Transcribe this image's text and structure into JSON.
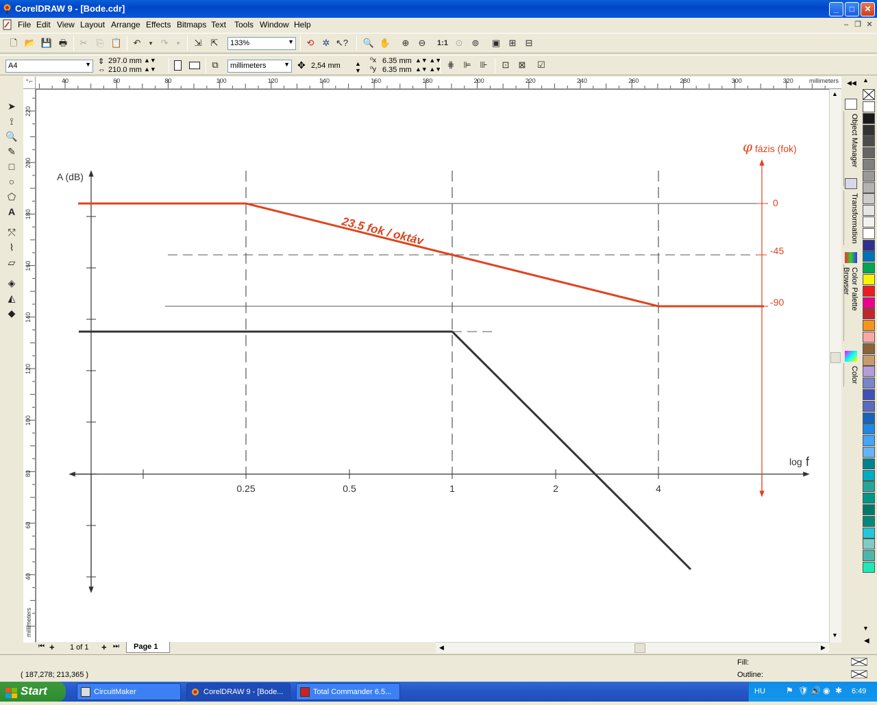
{
  "window": {
    "title": "CorelDRAW 9 - [Bode.cdr]"
  },
  "menu": [
    "File",
    "Edit",
    "View",
    "Layout",
    "Arrange",
    "Effects",
    "Bitmaps",
    "Text",
    "Tools",
    "Window",
    "Help"
  ],
  "toolbar": {
    "zoom": "133%"
  },
  "propertybar": {
    "paper": "A4",
    "width": "297.0 mm",
    "height": "210.0 mm",
    "units": "millimeters",
    "nudge": "2,54 mm",
    "dup_x": "6.35 mm",
    "dup_y": "6.35 mm"
  },
  "ruler": {
    "unit": "millimeters",
    "h_labels": [
      "40",
      "60",
      "80",
      "100",
      "120",
      "140",
      "160",
      "180",
      "200",
      "220",
      "240",
      "260",
      "280",
      "300",
      "320"
    ],
    "v_labels": [
      "220",
      "200",
      "180",
      "160",
      "140",
      "120",
      "100",
      "80",
      "60",
      "40"
    ]
  },
  "drawing": {
    "amp_axis_label": "A (dB)",
    "phase_axis_symbol": "φ",
    "phase_axis_label": "fázis (fok)",
    "freq_axis_label": "log",
    "freq_axis_var": "f",
    "freq_ticks": [
      "0.25",
      "0.5",
      "1",
      "2",
      "4"
    ],
    "phase_ticks": [
      "0",
      "-45",
      "-90"
    ],
    "slope_label": "23.5 fok / oktáv",
    "accent_color": "#e0431c",
    "amp_color": "#333333"
  },
  "pagebar": {
    "page_count": "1 of 1",
    "page_tab": "Page 1"
  },
  "dockers": [
    "Object Manager",
    "Transformation",
    "Color Palette Browser",
    "Color"
  ],
  "status": {
    "coords": "( 187,278; 213,365 )",
    "fill_label": "Fill:",
    "outline_label": "Outline:"
  },
  "taskbar": {
    "start": "Start",
    "tasks": [
      "CircuitMaker",
      "CorelDRAW 9 - [Bode...",
      "Total Commander 6.5..."
    ],
    "lang": "HU",
    "clock": "6:49"
  },
  "palette": [
    "#ffffff",
    "#1a1a1a",
    "#333333",
    "#4d4d4d",
    "#666666",
    "#808080",
    "#999999",
    "#b3b3b3",
    "#cccccc",
    "#e6e6e6",
    "#f2f2f2",
    "#ffffff",
    "#2e3192",
    "#0072bc",
    "#00a651",
    "#fff200",
    "#ed1c24",
    "#ec008c",
    "#c1272d",
    "#f7941d",
    "#f9a7a7",
    "#8c6239",
    "#c69c6d",
    "#b39ddb",
    "#7986cb",
    "#3f51b5",
    "#5c6bc0",
    "#1565c0",
    "#1e88e5",
    "#42a5f5",
    "#64b5f6",
    "#00838f",
    "#00acc1",
    "#26a69a",
    "#009688",
    "#00796b",
    "#00897b",
    "#26c6da",
    "#80cbc4",
    "#4db6ac",
    "#1de9b6"
  ]
}
